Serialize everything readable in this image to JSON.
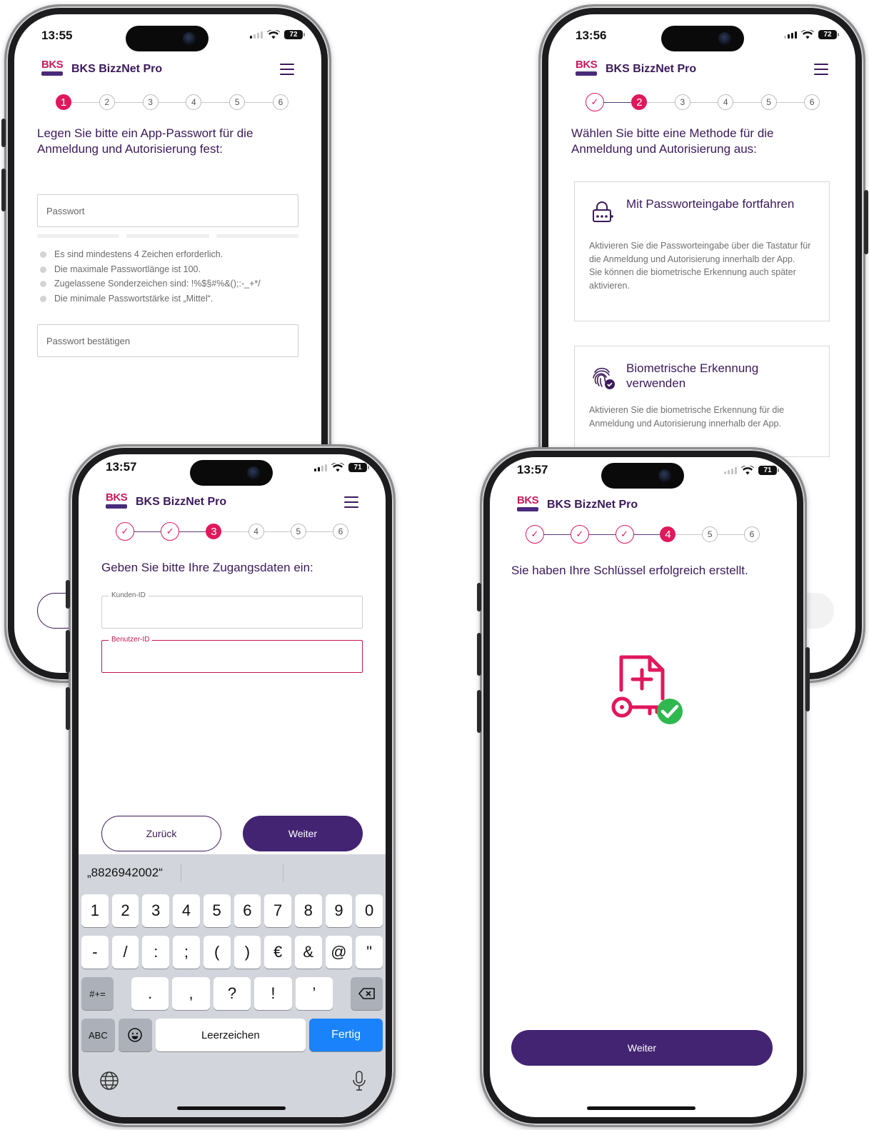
{
  "app": {
    "brand": "BKS",
    "title": "BKS BizzNet Pro"
  },
  "phone1": {
    "time": "13:55",
    "battery": "72",
    "steps": [
      "1",
      "2",
      "3",
      "4",
      "5",
      "6"
    ],
    "heading": "Legen Sie bitte ein App-Passwort für die Anmeldung und Autorisierung fest:",
    "password_placeholder": "Passwort",
    "rules": [
      "Es sind mindestens 4 Zeichen erforderlich.",
      "Die maximale Passwortlänge ist 100.",
      "Zugelassene Sonderzeichen sind: !%$§#%&();:-_+*/",
      "Die minimale Passwortstärke ist „Mittel“."
    ],
    "confirm_placeholder": "Passwort bestätigen"
  },
  "phone2": {
    "time": "13:56",
    "battery": "72",
    "steps": [
      "✓",
      "2",
      "3",
      "4",
      "5",
      "6"
    ],
    "heading": "Wählen Sie bitte eine Methode für die Anmeldung und Autorisierung aus:",
    "card_password": {
      "title": "Mit Passworteingabe fortfahren",
      "description": "Aktivieren Sie die Passworteingabe über die Tastatur für die Anmeldung und Autorisierung innerhalb der App.\nSie können die biometrische Erkennung auch später aktivieren."
    },
    "card_biometric": {
      "title": "Biometrische Erkennung verwenden",
      "description": "Aktivieren Sie die biometrische Erkennung für die Anmeldung und Autorisierung innerhalb der App."
    }
  },
  "phone3": {
    "time": "13:57",
    "battery": "71",
    "steps": [
      "✓",
      "✓",
      "3",
      "4",
      "5",
      "6"
    ],
    "heading": "Geben Sie bitte Ihre Zugangsdaten ein:",
    "customer_id_label": "Kunden-ID",
    "user_id_label": "Benutzer-ID",
    "back_label": "Zurück",
    "next_label": "Weiter",
    "keyboard": {
      "suggestion": "„8826942002“",
      "row1": [
        "1",
        "2",
        "3",
        "4",
        "5",
        "6",
        "7",
        "8",
        "9",
        "0"
      ],
      "row2": [
        "-",
        "/",
        ":",
        ";",
        "(",
        ")",
        "€",
        "&",
        "@",
        "\""
      ],
      "row3_left": "#+=",
      "row3": [
        ".",
        ",",
        "?",
        "!",
        "’"
      ],
      "abc": "ABC",
      "space": "Leerzeichen",
      "done": "Fertig"
    }
  },
  "phone4": {
    "time": "13:57",
    "battery": "71",
    "steps": [
      "✓",
      "✓",
      "✓",
      "4",
      "5",
      "6"
    ],
    "heading": "Sie haben Ihre Schlüssel erfolgreich erstellt.",
    "next_label": "Weiter"
  },
  "colors": {
    "accent": "#e0185c",
    "primary": "#432472",
    "success": "#2fb84f",
    "keyboard_blue": "#1a82fb"
  },
  "icons": [
    "hamburger-menu-icon",
    "lock-icon",
    "fingerprint-icon",
    "document-key-icon",
    "checkmark-icon",
    "globe-icon",
    "microphone-icon",
    "backspace-icon",
    "emoji-icon",
    "wifi-icon",
    "battery-icon"
  ]
}
